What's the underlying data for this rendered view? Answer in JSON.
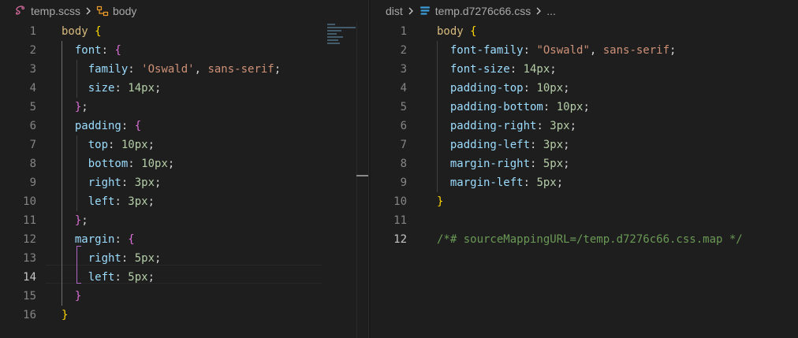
{
  "left": {
    "breadcrumb": {
      "file": "temp.scss",
      "symbol": "body"
    },
    "active_line": 14,
    "lines": [
      {
        "n": "1",
        "tokens": [
          [
            "body",
            "t-sel"
          ],
          [
            " ",
            "t-p"
          ],
          [
            "{",
            "t-b1"
          ]
        ]
      },
      {
        "n": "2",
        "tokens": [
          [
            "  ",
            "t-p"
          ],
          [
            "font",
            "t-prop"
          ],
          [
            ": ",
            "t-p"
          ],
          [
            "{",
            "t-b2"
          ]
        ]
      },
      {
        "n": "3",
        "tokens": [
          [
            "    ",
            "t-p"
          ],
          [
            "family",
            "t-prop"
          ],
          [
            ": ",
            "t-p"
          ],
          [
            "'Oswald'",
            "t-val"
          ],
          [
            ", ",
            "t-p"
          ],
          [
            "sans-serif",
            "t-val"
          ],
          [
            ";",
            "t-p"
          ]
        ]
      },
      {
        "n": "4",
        "tokens": [
          [
            "    ",
            "t-p"
          ],
          [
            "size",
            "t-prop"
          ],
          [
            ": ",
            "t-p"
          ],
          [
            "14px",
            "t-num"
          ],
          [
            ";",
            "t-p"
          ]
        ]
      },
      {
        "n": "5",
        "tokens": [
          [
            "  ",
            "t-p"
          ],
          [
            "}",
            "t-b2"
          ],
          [
            ";",
            "t-p"
          ]
        ]
      },
      {
        "n": "6",
        "tokens": [
          [
            "  ",
            "t-p"
          ],
          [
            "padding",
            "t-prop"
          ],
          [
            ": ",
            "t-p"
          ],
          [
            "{",
            "t-b2"
          ]
        ]
      },
      {
        "n": "7",
        "tokens": [
          [
            "    ",
            "t-p"
          ],
          [
            "top",
            "t-prop"
          ],
          [
            ": ",
            "t-p"
          ],
          [
            "10px",
            "t-num"
          ],
          [
            ";",
            "t-p"
          ]
        ]
      },
      {
        "n": "8",
        "tokens": [
          [
            "    ",
            "t-p"
          ],
          [
            "bottom",
            "t-prop"
          ],
          [
            ": ",
            "t-p"
          ],
          [
            "10px",
            "t-num"
          ],
          [
            ";",
            "t-p"
          ]
        ]
      },
      {
        "n": "9",
        "tokens": [
          [
            "    ",
            "t-p"
          ],
          [
            "right",
            "t-prop"
          ],
          [
            ": ",
            "t-p"
          ],
          [
            "3px",
            "t-num"
          ],
          [
            ";",
            "t-p"
          ]
        ]
      },
      {
        "n": "10",
        "tokens": [
          [
            "    ",
            "t-p"
          ],
          [
            "left",
            "t-prop"
          ],
          [
            ": ",
            "t-p"
          ],
          [
            "3px",
            "t-num"
          ],
          [
            ";",
            "t-p"
          ]
        ]
      },
      {
        "n": "11",
        "tokens": [
          [
            "  ",
            "t-p"
          ],
          [
            "}",
            "t-b2"
          ],
          [
            ";",
            "t-p"
          ]
        ]
      },
      {
        "n": "12",
        "tokens": [
          [
            "  ",
            "t-p"
          ],
          [
            "margin",
            "t-prop"
          ],
          [
            ": ",
            "t-p"
          ],
          [
            "{",
            "t-b2"
          ]
        ]
      },
      {
        "n": "13",
        "tokens": [
          [
            "    ",
            "t-p"
          ],
          [
            "right",
            "t-prop"
          ],
          [
            ": ",
            "t-p"
          ],
          [
            "5px",
            "t-num"
          ],
          [
            ";",
            "t-p"
          ]
        ]
      },
      {
        "n": "14",
        "tokens": [
          [
            "    ",
            "t-p"
          ],
          [
            "left",
            "t-prop"
          ],
          [
            ": ",
            "t-p"
          ],
          [
            "5px",
            "t-num"
          ],
          [
            ";",
            "t-p"
          ]
        ]
      },
      {
        "n": "15",
        "tokens": [
          [
            "  ",
            "t-p"
          ],
          [
            "}",
            "t-b2"
          ]
        ]
      },
      {
        "n": "16",
        "tokens": [
          [
            "}",
            "t-b1"
          ]
        ]
      }
    ]
  },
  "right": {
    "breadcrumb": {
      "folder": "dist",
      "file": "temp.d7276c66.css",
      "symbol": "..."
    },
    "active_line": 12,
    "lines": [
      {
        "n": "1",
        "tokens": [
          [
            "body",
            "t-sel"
          ],
          [
            " ",
            "t-p"
          ],
          [
            "{",
            "t-b1"
          ]
        ]
      },
      {
        "n": "2",
        "tokens": [
          [
            "  ",
            "t-p"
          ],
          [
            "font-family",
            "t-prop"
          ],
          [
            ": ",
            "t-p"
          ],
          [
            "\"Oswald\"",
            "t-val"
          ],
          [
            ", ",
            "t-p"
          ],
          [
            "sans-serif",
            "t-val"
          ],
          [
            ";",
            "t-p"
          ]
        ]
      },
      {
        "n": "3",
        "tokens": [
          [
            "  ",
            "t-p"
          ],
          [
            "font-size",
            "t-prop"
          ],
          [
            ": ",
            "t-p"
          ],
          [
            "14px",
            "t-num"
          ],
          [
            ";",
            "t-p"
          ]
        ]
      },
      {
        "n": "4",
        "tokens": [
          [
            "  ",
            "t-p"
          ],
          [
            "padding-top",
            "t-prop"
          ],
          [
            ": ",
            "t-p"
          ],
          [
            "10px",
            "t-num"
          ],
          [
            ";",
            "t-p"
          ]
        ]
      },
      {
        "n": "5",
        "tokens": [
          [
            "  ",
            "t-p"
          ],
          [
            "padding-bottom",
            "t-prop"
          ],
          [
            ": ",
            "t-p"
          ],
          [
            "10px",
            "t-num"
          ],
          [
            ";",
            "t-p"
          ]
        ]
      },
      {
        "n": "6",
        "tokens": [
          [
            "  ",
            "t-p"
          ],
          [
            "padding-right",
            "t-prop"
          ],
          [
            ": ",
            "t-p"
          ],
          [
            "3px",
            "t-num"
          ],
          [
            ";",
            "t-p"
          ]
        ]
      },
      {
        "n": "7",
        "tokens": [
          [
            "  ",
            "t-p"
          ],
          [
            "padding-left",
            "t-prop"
          ],
          [
            ": ",
            "t-p"
          ],
          [
            "3px",
            "t-num"
          ],
          [
            ";",
            "t-p"
          ]
        ]
      },
      {
        "n": "8",
        "tokens": [
          [
            "  ",
            "t-p"
          ],
          [
            "margin-right",
            "t-prop"
          ],
          [
            ": ",
            "t-p"
          ],
          [
            "5px",
            "t-num"
          ],
          [
            ";",
            "t-p"
          ]
        ]
      },
      {
        "n": "9",
        "tokens": [
          [
            "  ",
            "t-p"
          ],
          [
            "margin-left",
            "t-prop"
          ],
          [
            ": ",
            "t-p"
          ],
          [
            "5px",
            "t-num"
          ],
          [
            ";",
            "t-p"
          ]
        ]
      },
      {
        "n": "10",
        "tokens": [
          [
            "}",
            "t-b1"
          ]
        ]
      },
      {
        "n": "11",
        "tokens": []
      },
      {
        "n": "12",
        "tokens": [
          [
            "/*# sourceMappingURL=/temp.d7276c66.css.map */",
            "t-cm"
          ]
        ]
      }
    ]
  },
  "icons": {
    "scss_file": "sass-file-icon",
    "css_file": "css-file-icon",
    "symbol": "symbol-structure-icon",
    "separator": "chevron-right-icon"
  },
  "colors": {
    "background": "#1e1e1e",
    "line_number": "#858585",
    "selector": "#d7ba7d",
    "property": "#9cdcfe",
    "string": "#ce9178",
    "number": "#b5cea8",
    "bracket_1": "#ffd700",
    "bracket_2": "#da70d6",
    "comment": "#6a9955",
    "sass_icon": "#cd6799",
    "css_icon": "#3c9cd7"
  }
}
